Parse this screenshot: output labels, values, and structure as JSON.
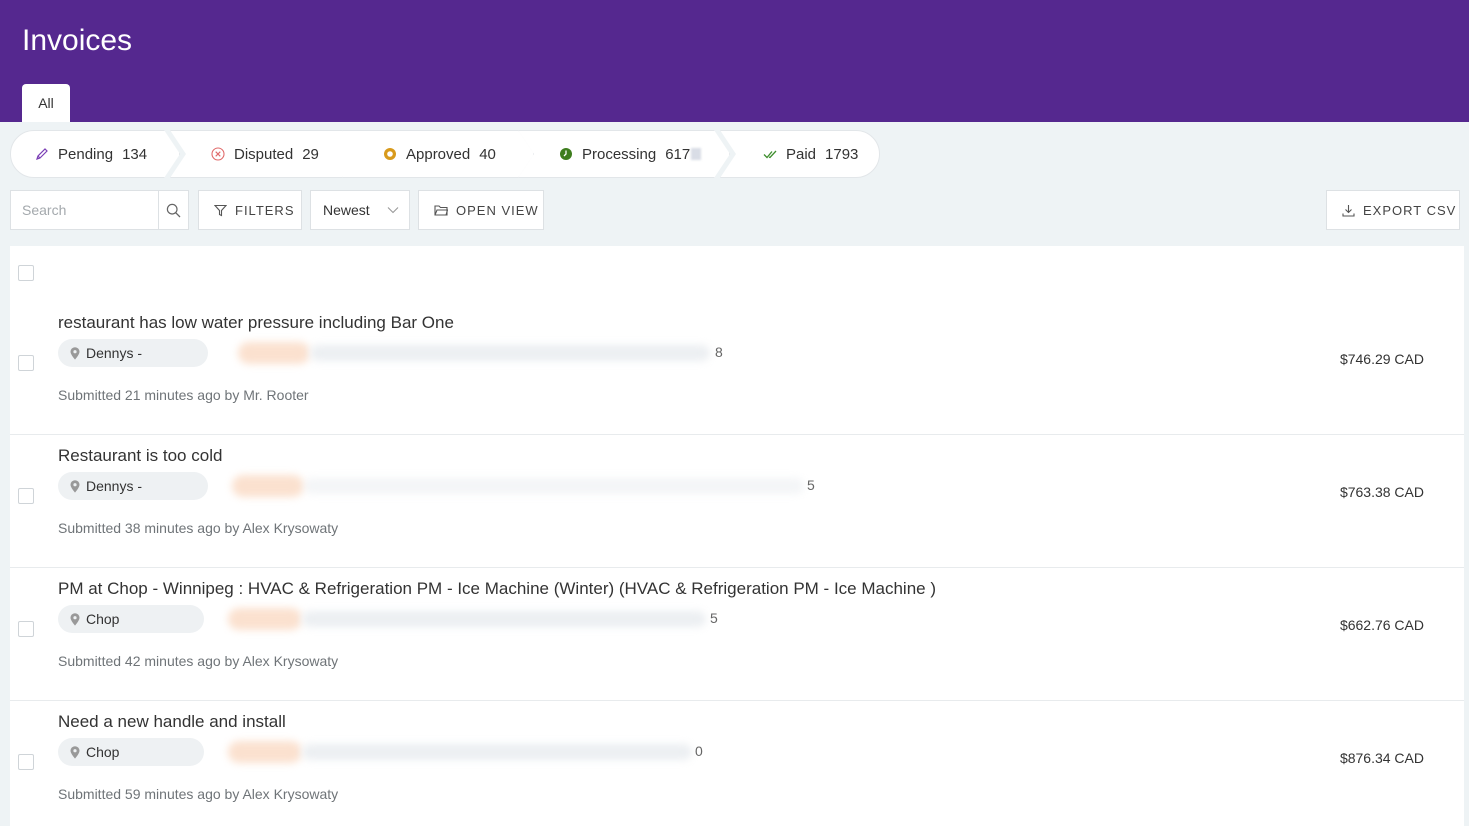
{
  "header": {
    "title": "Invoices",
    "tabs": [
      {
        "label": "All"
      }
    ]
  },
  "status_bar": [
    {
      "label": "Pending",
      "count": "134",
      "icon": "pencil-icon",
      "color": "#7b3fb5"
    },
    {
      "label": "Disputed",
      "count": "29",
      "icon": "x-circle-icon",
      "color": "#e06a6a"
    },
    {
      "label": "Approved",
      "count": "40",
      "icon": "approved-icon",
      "color": "#d89a1c"
    },
    {
      "label": "Processing",
      "count": "617",
      "icon": "processing-icon",
      "color": "#3e7d1e"
    },
    {
      "label": "Paid",
      "count": "1793",
      "icon": "check-icon",
      "color": "#3e8e2e"
    }
  ],
  "toolbar": {
    "search_placeholder": "Search",
    "filters_label": "FILTERS",
    "sort_value": "Newest",
    "open_view_label": "OPEN VIEW",
    "export_label": "EXPORT CSV"
  },
  "invoices": [
    {
      "title": "restaurant has low water pressure including Bar One",
      "location": "Dennys -",
      "location_tail": "8",
      "submitted": "Submitted 21 minutes ago by Mr. Rooter",
      "amount": "$746.29 CAD"
    },
    {
      "title": "Restaurant is too cold",
      "location": "Dennys -",
      "location_tail": "5",
      "submitted": "Submitted 38 minutes ago by Alex Krysowaty",
      "amount": "$763.38 CAD"
    },
    {
      "title": "PM at Chop - Winnipeg : HVAC & Refrigeration PM - Ice Machine (Winter) (HVAC & Refrigeration PM - Ice Machine )",
      "location": "Chop",
      "location_tail": "5",
      "submitted": "Submitted 42 minutes ago by Alex Krysowaty",
      "amount": "$662.76 CAD"
    },
    {
      "title": "Need a new handle and install",
      "location": "Chop",
      "location_tail": "0",
      "submitted": "Submitted 59 minutes ago by Alex Krysowaty",
      "amount": "$876.34 CAD"
    }
  ],
  "colors": {
    "header_bg": "#55288f",
    "page_bg": "#eef3f5"
  }
}
